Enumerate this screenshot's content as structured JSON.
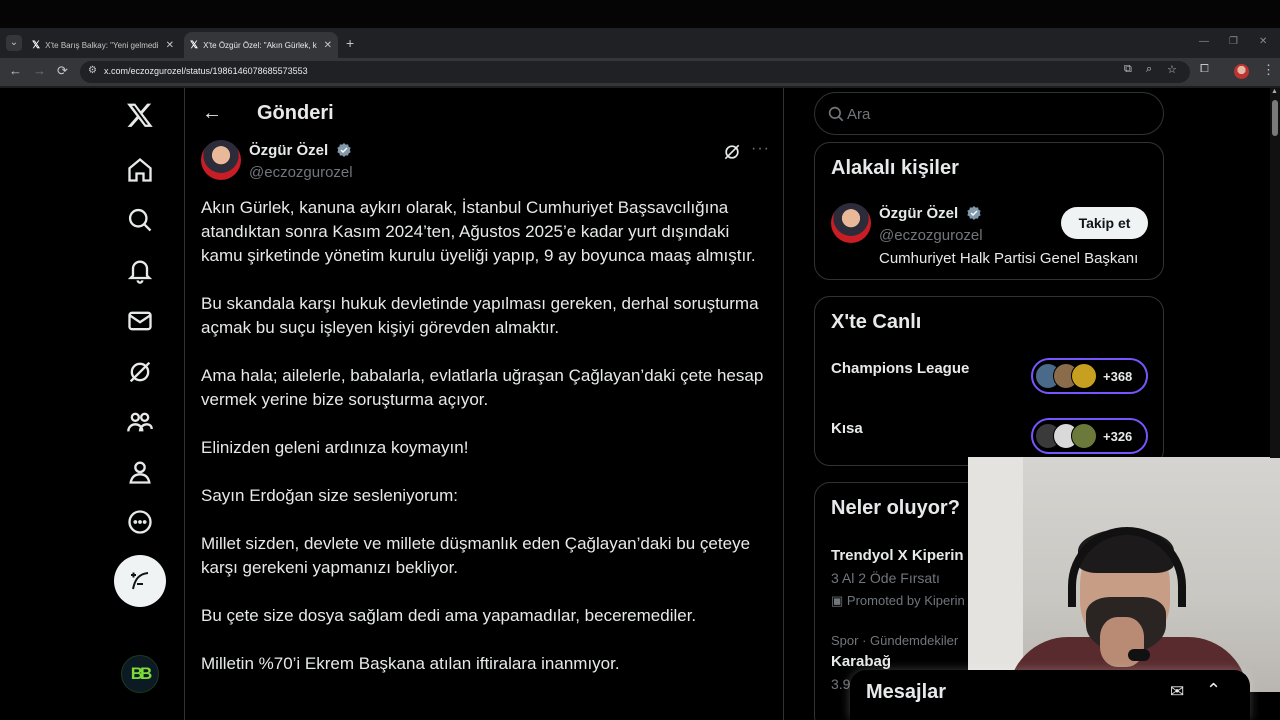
{
  "browser": {
    "tabs": [
      {
        "title": "X'te Barış Balkay: \"Yeni gelmedi",
        "active": false
      },
      {
        "title": "X'te Özgür Özel: \"Akın Gürlek, k",
        "active": true
      }
    ],
    "url": "x.com/eczozgurozel/status/1986146078685573553",
    "icons": {
      "back": "←",
      "forward": "→",
      "reload": "⟳",
      "new_tab": "+",
      "close": "✕",
      "minimize": "—",
      "restore": "❐",
      "window_close": "✕",
      "menu": "⋮",
      "star": "☆"
    }
  },
  "nav": {
    "items": [
      "x-logo",
      "home",
      "explore",
      "notifications",
      "messages",
      "grok",
      "communities",
      "profile",
      "more"
    ],
    "post_label": "Post",
    "account_avatar_text": "BB"
  },
  "post": {
    "page_title": "Gönderi",
    "author_name": "Özgür Özel",
    "author_handle": "@eczozgurozel",
    "paragraphs": [
      "Akın Gürlek, kanuna aykırı olarak, İstanbul Cumhuriyet Başsavcılığına atandıktan sonra Kasım 2024’ten, Ağustos 2025’e kadar yurt dışındaki kamu şirketinde yönetim kurulu üyeliği yapıp, 9 ay boyunca maaş almıştır.",
      "Bu skandala karşı hukuk devletinde yapılması gereken, derhal soruşturma açmak bu suçu işleyen kişiyi görevden almaktır.",
      "Ama hala; ailelerle, babalarla, evlatlarla uğraşan Çağlayan’daki çete hesap vermek yerine bize soruşturma açıyor.",
      "Elinizden geleni ardınıza koymayın!",
      "Sayın Erdoğan size sesleniyorum:",
      "Millet sizden, devlete ve millete düşmanlık eden Çağlayan’daki bu çeteye karşı gerekeni yapmanızı bekliyor.",
      "Bu çete size dosya sağlam dedi ama yapamadılar, beceremediler.",
      "Milletin %70’i Ekrem Başkana atılan iftiralara inanmıyor."
    ]
  },
  "sidebar": {
    "search_placeholder": "Ara",
    "related": {
      "title": "Alakalı kişiler",
      "name": "Özgür Özel",
      "handle": "@eczozgurozel",
      "bio": "Cumhuriyet Halk Partisi Genel Başkanı",
      "follow_label": "Takip et"
    },
    "live": {
      "title": "X'te Canlı",
      "items": [
        {
          "label": "Champions League",
          "count": "+368"
        },
        {
          "label": "Kısa",
          "count": "+326"
        }
      ]
    },
    "trends": {
      "title": "Neler oluyor?",
      "promo_title": "Trendyol X Kiperin",
      "promo_sub": "3 Al 2 Öde Fırsatı",
      "promo_label": "Promoted by Kiperin",
      "trend_context": "Spor · Gündemdekiler",
      "trend_name": "Karabağ",
      "trend_count": "3.9"
    }
  },
  "messages": {
    "title": "Mesajlar"
  },
  "colors": {
    "background": "#000000",
    "text": "#e7e9ea",
    "muted": "#71767b",
    "border": "#2f3336",
    "verified": "#829aab",
    "live_border": "#7856ff"
  }
}
